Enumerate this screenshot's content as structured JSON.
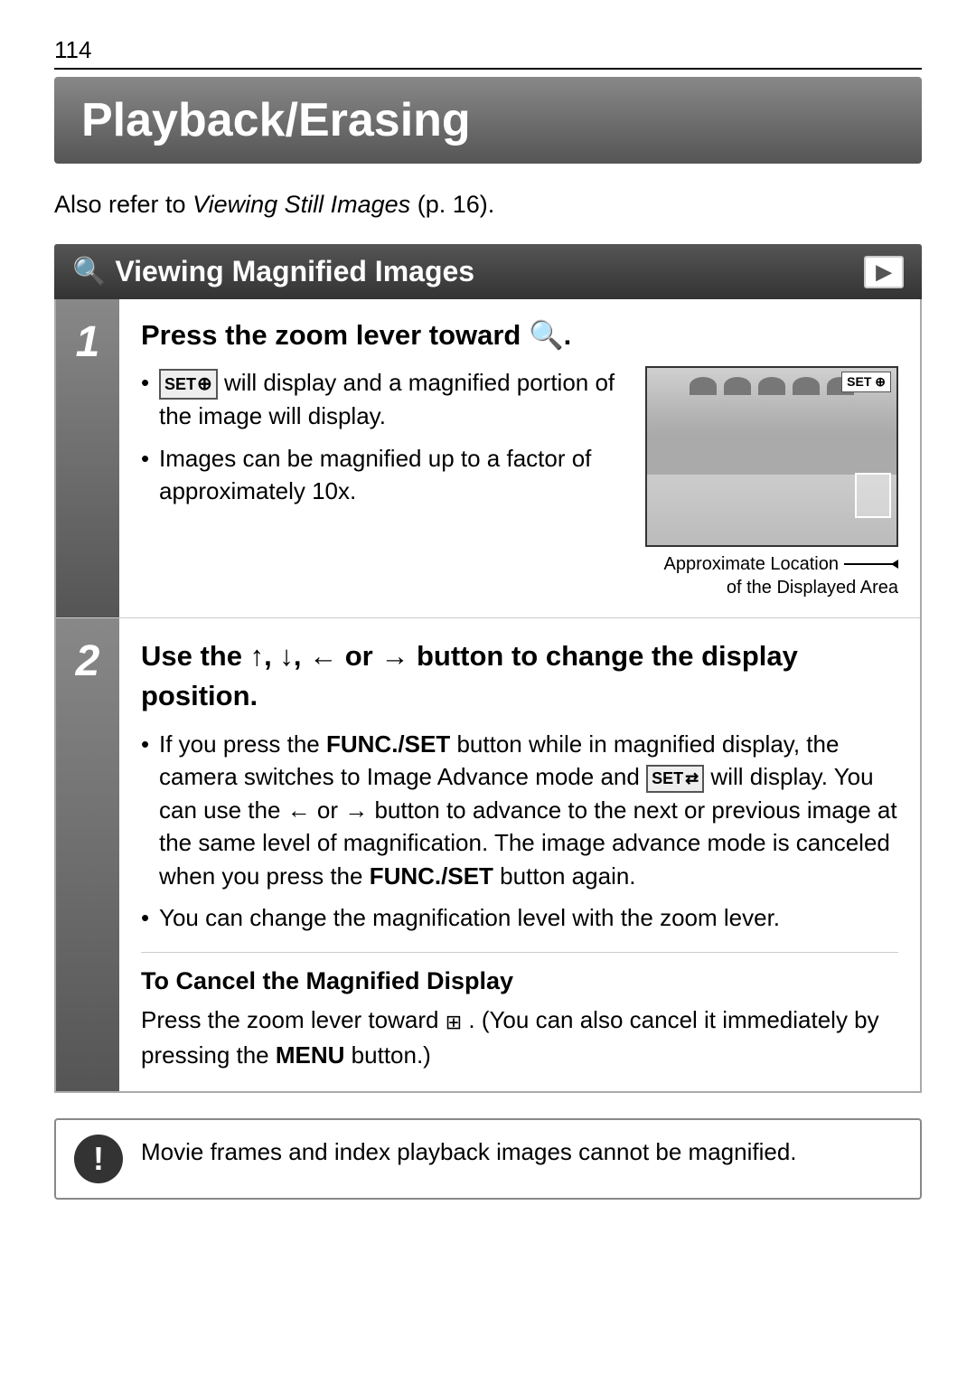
{
  "page": {
    "number": "114",
    "chapter_title": "Playback/Erasing",
    "intro": {
      "text": "Also refer to ",
      "link_text": "Viewing Still Images",
      "page_ref": "(p. 16).",
      "italic_text": "Viewing Still Images"
    },
    "section": {
      "title": "Viewing Magnified Images",
      "search_icon": "🔍",
      "playback_icon": "▶"
    },
    "step1": {
      "number": "1",
      "heading": "Press the zoom lever toward 🔍.",
      "heading_plain": "Press the zoom lever toward",
      "bullets": [
        {
          "text_before": " will display and a magnified portion of the image will display.",
          "has_set_badge": true
        },
        {
          "text": "Images can be magnified up to a factor of approximately 10x.",
          "has_set_badge": false
        }
      ],
      "image_caption_line1": "Approximate Location",
      "image_caption_line2": "of the Displayed Area"
    },
    "step2": {
      "number": "2",
      "heading": "Use the ↑, ↓, ← or → button to change the display position.",
      "heading_plain": "Use the",
      "heading_arrows": "↑, ↓, ← or →",
      "heading_end": "button to change the display position.",
      "bullets": [
        {
          "text": "If you press the FUNC./SET button while in magnified display, the camera switches to Image Advance mode and  will display. You can use the ← or → button to advance to the next or previous image at the same level of magnification. The image advance mode is canceled when you press the FUNC./SET button again.",
          "func_set_bold": true
        },
        {
          "text": "You can change the magnification level with the zoom lever."
        }
      ]
    },
    "cancel_section": {
      "heading": "To Cancel the Magnified Display",
      "text": "Press the zoom lever toward  . (You can also cancel it immediately by pressing the MENU button.)",
      "text_plain": "Press the zoom lever toward",
      "text_mid": ". (You can also cancel it immediately by pressing the",
      "menu_bold": "MENU",
      "text_end": "button.)"
    },
    "warning": {
      "icon_label": "!",
      "text": "Movie frames and index playback images cannot be magnified."
    }
  }
}
